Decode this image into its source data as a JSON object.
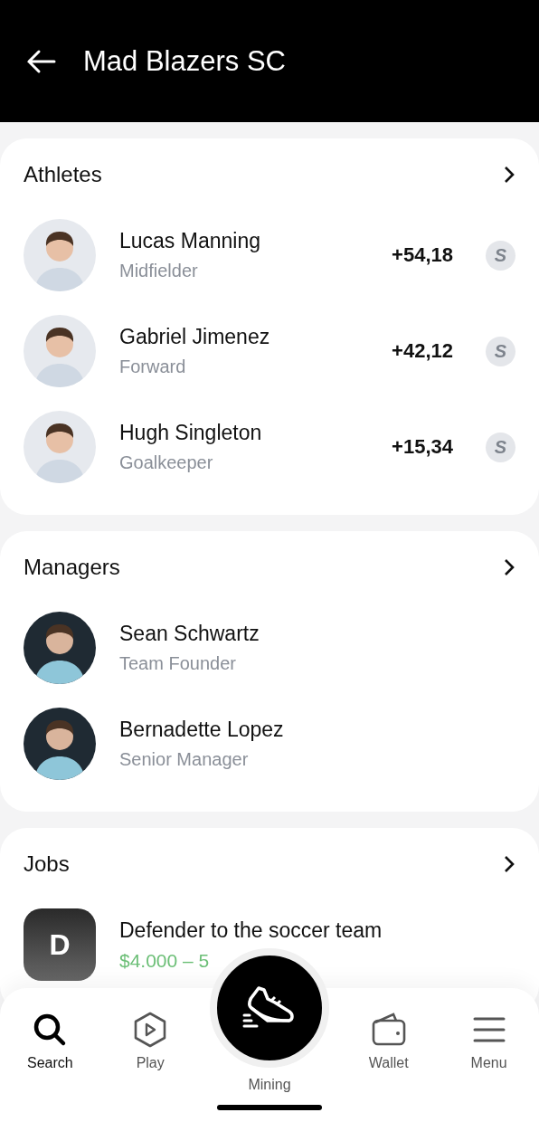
{
  "header": {
    "title": "Mad Blazers SC"
  },
  "sections": [
    {
      "title": "Athletes",
      "kind": "athletes",
      "items": [
        {
          "name": "Lucas Manning",
          "role": "Midfielder",
          "score": "+54,18",
          "coin": "S"
        },
        {
          "name": "Gabriel Jimenez",
          "role": "Forward",
          "score": "+42,12",
          "coin": "S"
        },
        {
          "name": "Hugh Singleton",
          "role": "Goalkeeper",
          "score": "+15,34",
          "coin": "S"
        }
      ]
    },
    {
      "title": "Managers",
      "kind": "people",
      "items": [
        {
          "name": "Sean Schwartz",
          "role": "Team Founder"
        },
        {
          "name": "Bernadette Lopez",
          "role": "Senior Manager"
        }
      ]
    },
    {
      "title": "Jobs",
      "kind": "jobs",
      "items": [
        {
          "letter": "D",
          "name": "Defender to the soccer team",
          "salary": "$4.000 – 5"
        }
      ]
    }
  ],
  "nav": [
    {
      "label": "Search",
      "kind": "tab",
      "selected": true
    },
    {
      "label": "Play",
      "kind": "tab",
      "selected": false
    },
    {
      "label": "Mining",
      "kind": "center",
      "selected": false
    },
    {
      "label": "Wallet",
      "kind": "tab",
      "selected": false
    },
    {
      "label": "Menu",
      "kind": "tab",
      "selected": false
    }
  ]
}
